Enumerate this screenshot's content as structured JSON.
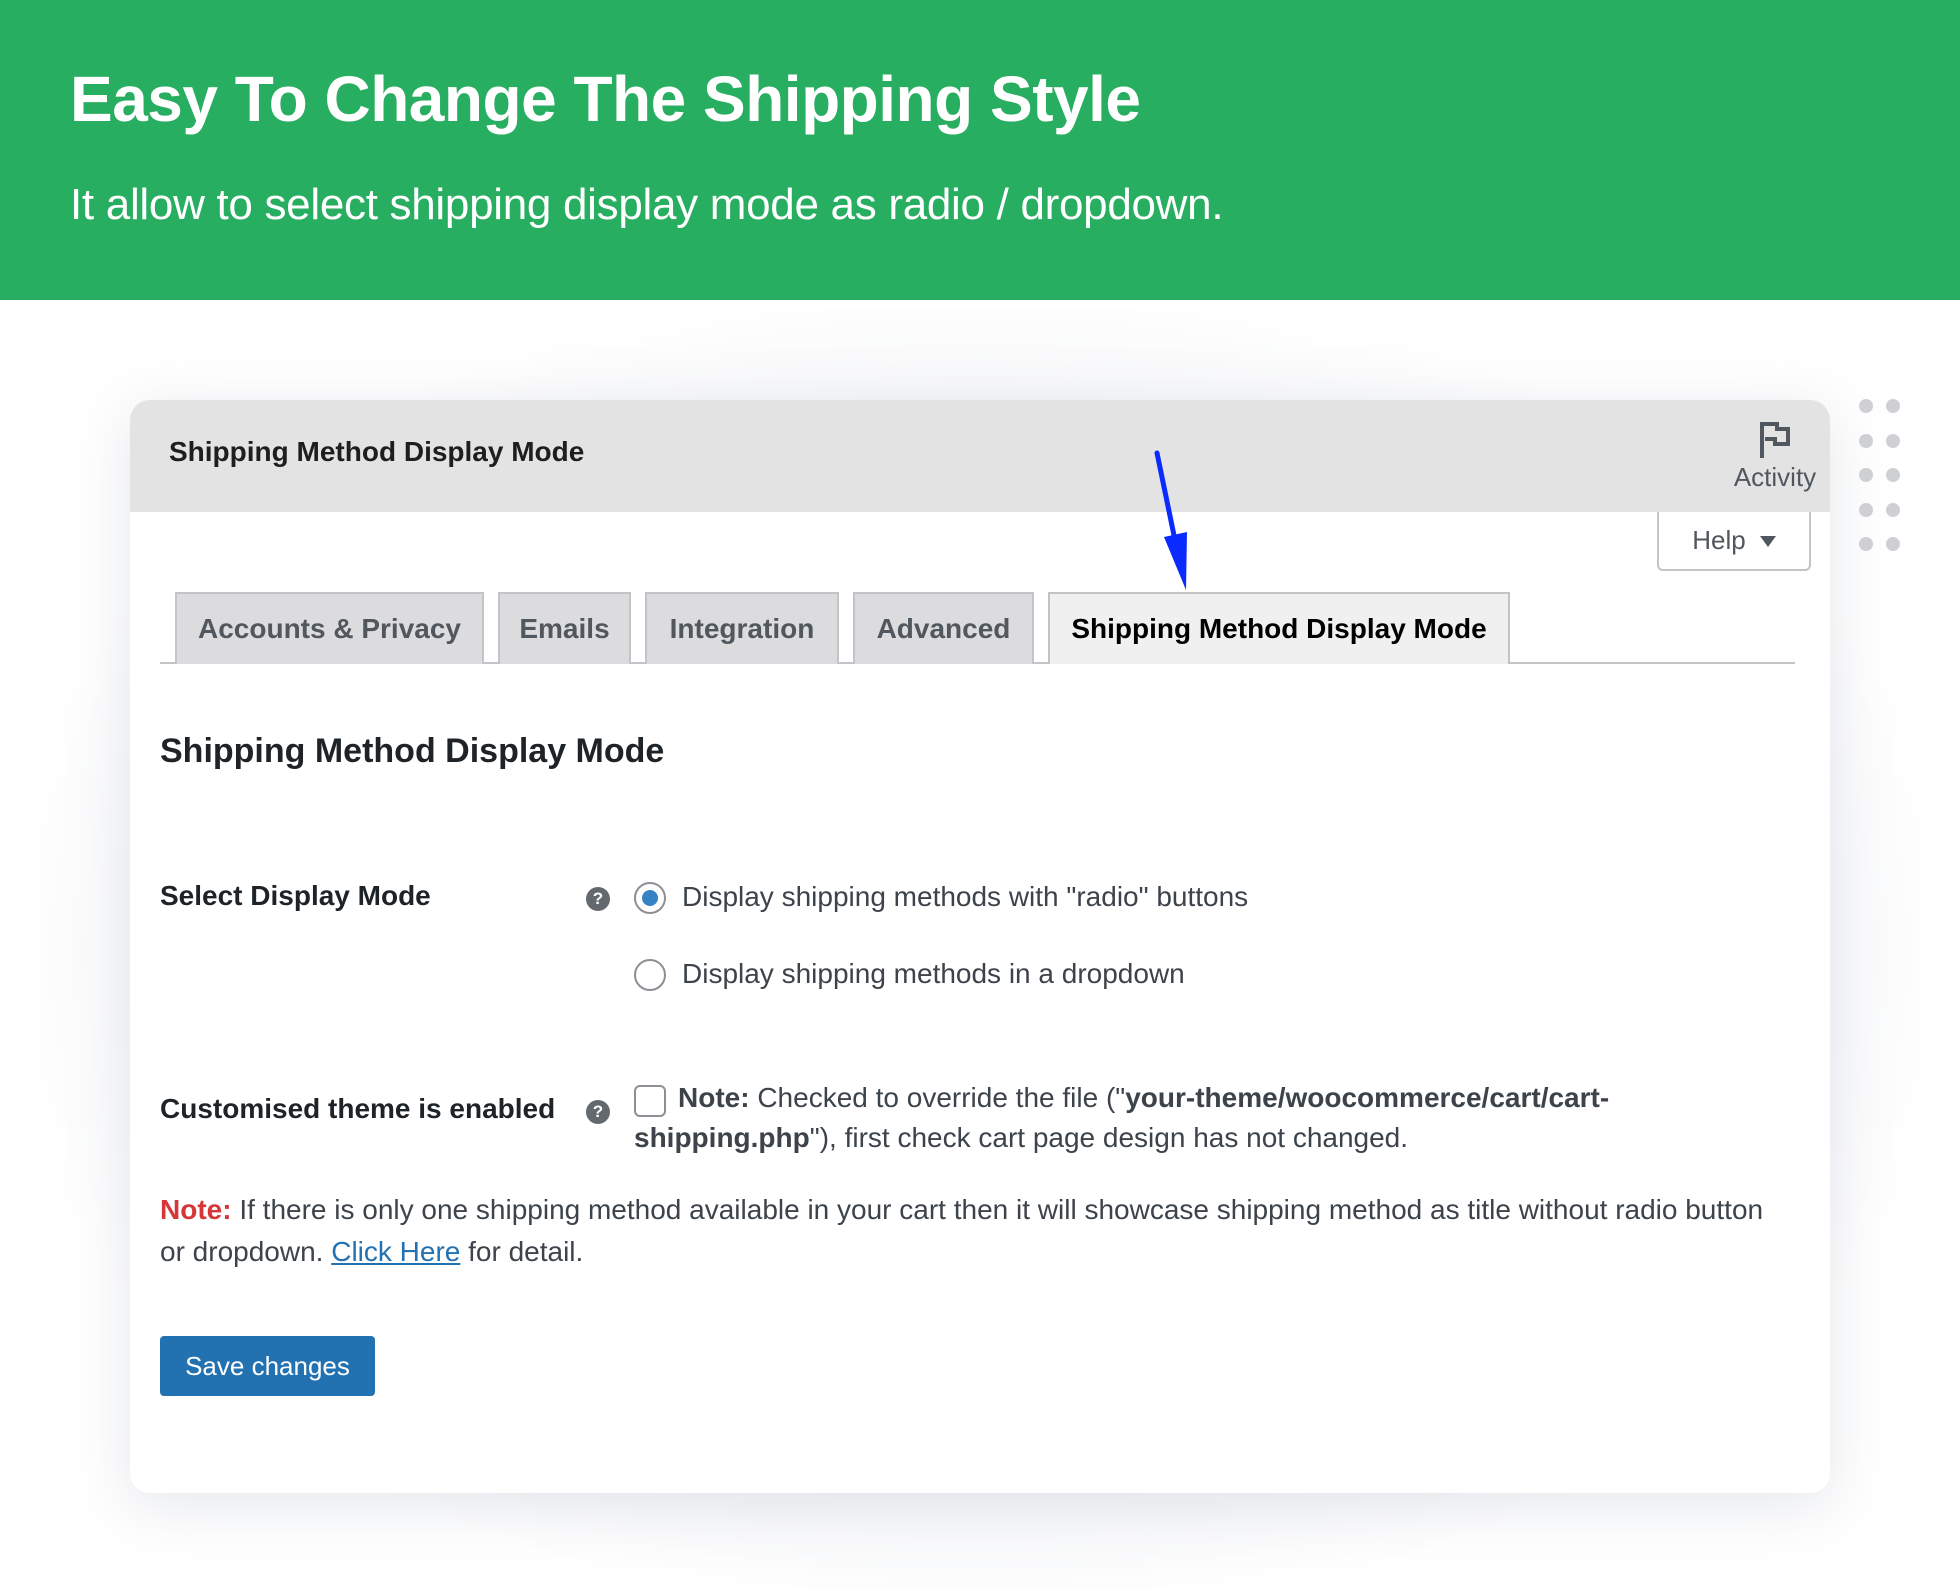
{
  "banner": {
    "title": "Easy To Change The Shipping Style",
    "subtitle": "It allow to select shipping display mode as radio / dropdown.",
    "background_color": "#28ae60"
  },
  "header": {
    "title": "Shipping Method Display Mode",
    "activity_label": "Activity",
    "activity_icon": "flag-icon"
  },
  "help_button": {
    "label": "Help",
    "icon": "caret-down-icon"
  },
  "tabs": [
    {
      "label": "Accounts & Privacy",
      "active": false
    },
    {
      "label": "Emails",
      "active": false
    },
    {
      "label": "Integration",
      "active": false
    },
    {
      "label": "Advanced",
      "active": false
    },
    {
      "label": "Shipping Method Display Mode",
      "active": true
    }
  ],
  "annotation": {
    "arrow_color": "#0a2bff",
    "points_to": "Shipping Method Display Mode tab"
  },
  "section": {
    "title": "Shipping Method Display Mode"
  },
  "fields": {
    "display_mode": {
      "label": "Select Display Mode",
      "help_icon": "?",
      "options": [
        {
          "label": "Display shipping methods with \"radio\" buttons",
          "checked": true
        },
        {
          "label": "Display shipping methods in a dropdown",
          "checked": false
        }
      ]
    },
    "custom_theme": {
      "label": "Customised theme is enabled",
      "help_icon": "?",
      "checked": false,
      "note_label": "Note:",
      "text_1": " Checked to override the file (\"",
      "path": "your-theme/woocommerce/cart/cart-shipping.php",
      "text_2": "\"), first check cart page design has not changed."
    }
  },
  "note": {
    "label": "Note:",
    "text": " If there is only one shipping method available in your cart then it will showcase shipping method as title without radio button or dropdown. ",
    "link_text": "Click Here",
    "after_link": " for detail.",
    "label_color": "#d63638",
    "link_color": "#2271b1"
  },
  "save_button": {
    "label": "Save changes",
    "color": "#2271b1"
  }
}
